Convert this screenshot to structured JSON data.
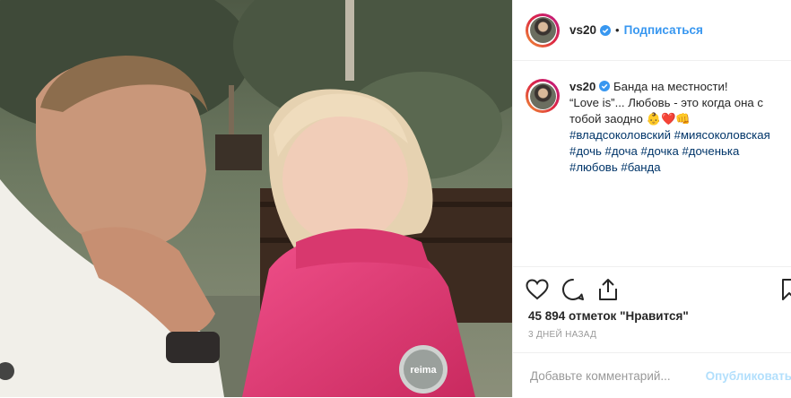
{
  "post": {
    "username": "vs20",
    "follow_label": "Подписаться",
    "dot": "•",
    "caption_line1": "Банда на местности!",
    "caption_line2": "“Love is”... Любовь - это когда она с тобой заодно",
    "caption_emoji": "👶❤️👊",
    "hashtags": [
      "#владсоколовский",
      "#миясоколовская",
      "#дочь",
      "#доча",
      "#дочка",
      "#доченька",
      "#любовь",
      "#банда"
    ],
    "likes": "45 894 отметок \"Нравится\"",
    "date": "3 ДНЕЙ НАЗАД",
    "comment_placeholder": "Добавьте комментарий...",
    "publish_label": "Опубликовать",
    "photo_text": "reima"
  },
  "icons": [
    "heart-icon",
    "comment-icon",
    "share-icon",
    "bookmark-icon",
    "verified-badge-icon"
  ],
  "colors": {
    "link": "#3897f0",
    "hashtag": "#003569",
    "jacket": "#e2366f"
  }
}
